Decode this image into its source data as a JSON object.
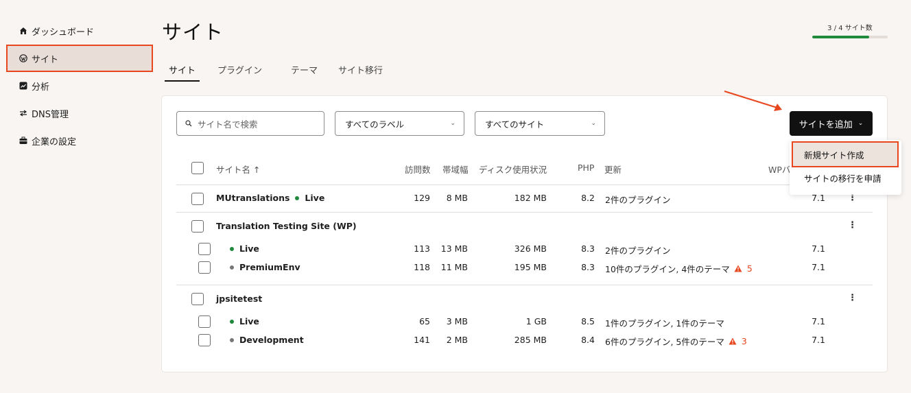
{
  "sidebar": {
    "items": [
      {
        "label": "ダッシュボード",
        "icon": "home-icon"
      },
      {
        "label": "サイト",
        "icon": "wordpress-icon"
      },
      {
        "label": "分析",
        "icon": "analytics-icon"
      },
      {
        "label": "DNS管理",
        "icon": "dns-icon"
      },
      {
        "label": "企業の設定",
        "icon": "briefcase-icon"
      }
    ]
  },
  "header": {
    "title": "サイト",
    "quota_label": "3 / 4 サイト数",
    "quota_fraction": 0.75
  },
  "tabs": [
    {
      "label": "サイト"
    },
    {
      "label": "プラグイン"
    },
    {
      "label": "テーマ"
    },
    {
      "label": "サイト移行"
    }
  ],
  "toolbar": {
    "search_placeholder": "サイト名で検索",
    "label_filter": "すべてのラベル",
    "site_filter": "すべてのサイト",
    "add_button": "サイトを追加"
  },
  "menu": {
    "items": [
      "新規サイト作成",
      "サイトの移行を申請"
    ]
  },
  "table": {
    "headers": {
      "name": "サイト名 ↑",
      "visits": "訪問数",
      "bandwidth": "帯域幅",
      "disk": "ディスク使用状況",
      "php": "PHP",
      "updates": "更新",
      "wp": "WPバ"
    },
    "rows": [
      {
        "name": "MUtranslations",
        "env": "Live",
        "visits": "129",
        "bandwidth": "8 MB",
        "disk": "182 MB",
        "php": "8.2",
        "updates": "2件のプラグイン",
        "wp": "7.1"
      },
      {
        "name": "Translation Testing Site (WP)",
        "envs": [
          {
            "env": "Live",
            "visits": "113",
            "bandwidth": "13 MB",
            "disk": "326 MB",
            "php": "8.3",
            "updates": "2件のプラグイン",
            "wp": "7.1"
          },
          {
            "env": "PremiumEnv",
            "visits": "118",
            "bandwidth": "11 MB",
            "disk": "195 MB",
            "php": "8.3",
            "updates": "10件のプラグイン, 4件のテーマ",
            "warning": "5",
            "wp": "7.1"
          }
        ]
      },
      {
        "name": "jpsitetest",
        "envs": [
          {
            "env": "Live",
            "visits": "65",
            "bandwidth": "3 MB",
            "disk": "1 GB",
            "php": "8.5",
            "updates": "1件のプラグイン, 1件のテーマ",
            "wp": "7.1"
          },
          {
            "env": "Development",
            "visits": "141",
            "bandwidth": "2 MB",
            "disk": "285 MB",
            "php": "8.4",
            "updates": "6件のプラグイン, 5件のテーマ",
            "warning": "3",
            "wp": "7.1"
          }
        ]
      }
    ]
  },
  "colors": {
    "accent": "#e8461e",
    "live": "#1f8a3b",
    "button": "#111111"
  }
}
